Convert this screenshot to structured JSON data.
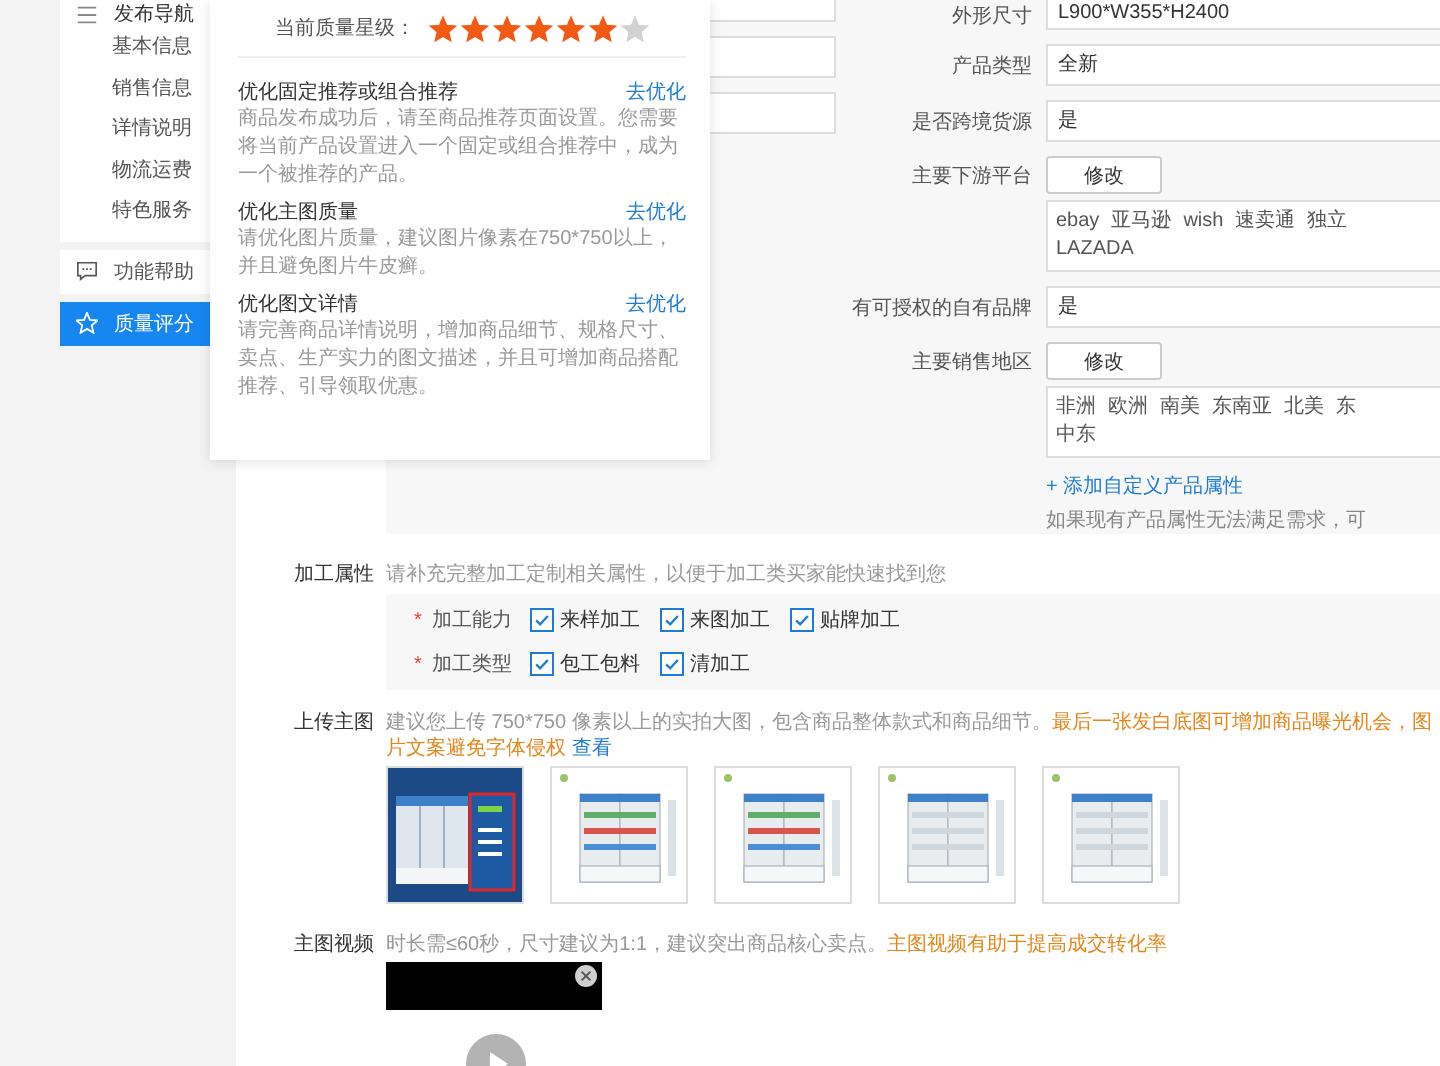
{
  "sidebar": {
    "nav_title": "发布导航",
    "nav_items": [
      {
        "label": "基本信息",
        "selected": false
      },
      {
        "label": "销售信息",
        "selected": false
      },
      {
        "label": "详情说明",
        "selected": false
      },
      {
        "label": "物流运费",
        "selected": false
      },
      {
        "label": "特色服务",
        "selected": false
      }
    ],
    "tools": [
      {
        "label": "功能帮助",
        "selected": false
      },
      {
        "label": "质量评分",
        "selected": true
      }
    ]
  },
  "quality_popup": {
    "label": "当前质量星级：",
    "stars": 6,
    "tips": [
      {
        "title": "优化固定推荐或组合推荐",
        "action": "去优化",
        "text": "商品发布成功后，请至商品推荐页面设置。您需要将当前产品设置进入一个固定或组合推荐中，成为一个被推荐的产品。"
      },
      {
        "title": "优化主图质量",
        "action": "去优化",
        "text": "请优化图片质量，建议图片像素在750*750以上，并且避免图片牛皮癣。"
      },
      {
        "title": "优化图文详情",
        "action": "去优化",
        "text": "请完善商品详情说明，增加商品细节、规格尺寸、卖点、生产实力的图文描述，并且可增加商品搭配推荐、引导领取优惠。"
      }
    ]
  },
  "attributes": [
    {
      "kind": "field",
      "label": "外形尺寸",
      "value": "L900*W355*H2400"
    },
    {
      "kind": "field",
      "label": "产品类型",
      "value": "全新"
    },
    {
      "kind": "field",
      "label": "是否跨境货源",
      "value": "是"
    },
    {
      "kind": "button",
      "label": "主要下游平台",
      "button": "修改"
    },
    {
      "kind": "list",
      "lines": [
        [
          "ebay",
          "亚马逊",
          "wish",
          "速卖通",
          "独立"
        ],
        [
          "LAZADA"
        ]
      ]
    },
    {
      "kind": "field",
      "label": "有可授权的自有品牌",
      "value": "是"
    },
    {
      "kind": "button",
      "label": "主要销售地区",
      "button": "修改"
    },
    {
      "kind": "list",
      "lines": [
        [
          "非洲",
          "欧洲",
          "南美",
          "东南亚",
          "北美",
          "东"
        ],
        [
          "中东"
        ]
      ]
    }
  ],
  "add_attribute_link": "+ 添加自定义产品属性",
  "attribute_note": "如果现有产品属性无法满足需求，可",
  "processing": {
    "label": "加工属性",
    "hint": "请补充完整加工定制相关属性，以便于加工类买家能快速找到您",
    "groups": [
      {
        "mark": "*",
        "label": "加工能力",
        "options": [
          {
            "label": "来样加工",
            "checked": true
          },
          {
            "label": "来图加工",
            "checked": true
          },
          {
            "label": "贴牌加工",
            "checked": true
          }
        ]
      },
      {
        "mark": "*",
        "label": "加工类型",
        "options": [
          {
            "label": "包工包料",
            "checked": true
          },
          {
            "label": "清加工",
            "checked": true
          }
        ]
      }
    ]
  },
  "main_images": {
    "label": "上传主图",
    "hint": "建议您上传 750*750 像素以上的实拍大图，包含商品整体款式和商品细节。",
    "warning": "最后一张发白底图可增加商品曝光机会，图片文案避免字体侵权",
    "link": "查看"
  },
  "video": {
    "label": "主图视频",
    "hint": "时长需≤60秒，尺寸建议为1:1，建议突出商品核心卖点。",
    "warning": "主图视频有助于提高成交转化率"
  }
}
